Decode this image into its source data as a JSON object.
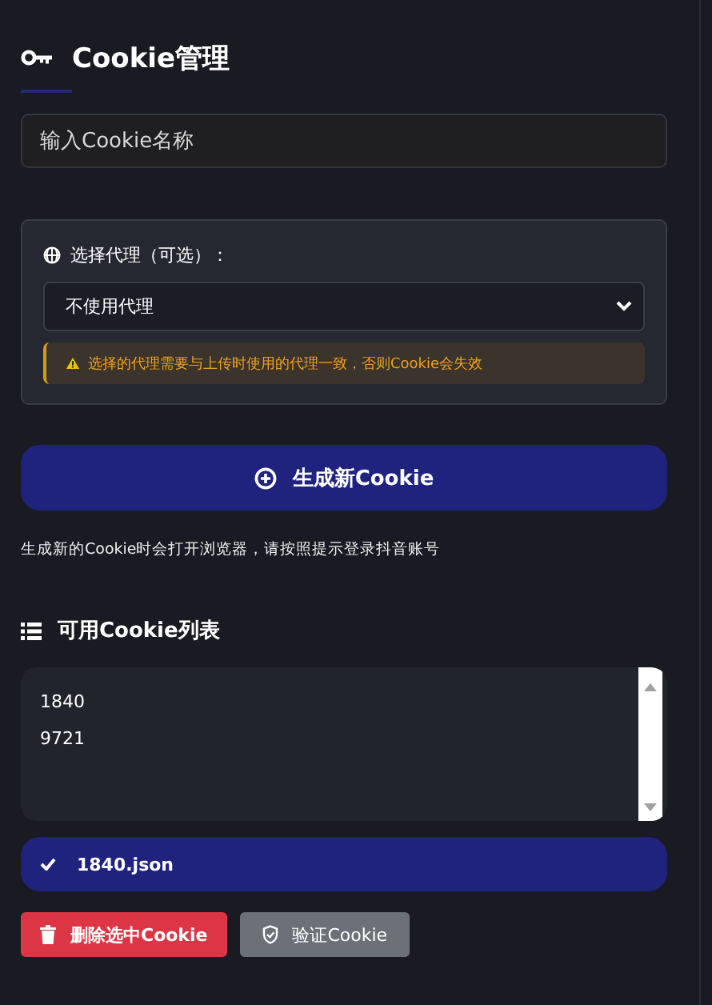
{
  "title": "Cookie管理",
  "name_field": {
    "placeholder": "输入Cookie名称"
  },
  "proxy": {
    "label": "选择代理（可选）：",
    "value": "不使用代理",
    "warning": "选择的代理需要与上传时使用的代理一致，否则Cookie会失效"
  },
  "generate_button": "生成新Cookie",
  "generate_note": "生成新的Cookie时会打开浏览器，请按照提示登录抖音账号",
  "list_heading": "可用Cookie列表",
  "cookies": [
    {
      "label": "1840",
      "selected": false
    },
    {
      "label": "9721",
      "selected": false
    }
  ],
  "selected_file": "1840.json",
  "buttons": [
    {
      "kind": "danger",
      "label": "删除选中Cookie"
    },
    {
      "kind": "secondary",
      "label": "验证Cookie"
    }
  ]
}
